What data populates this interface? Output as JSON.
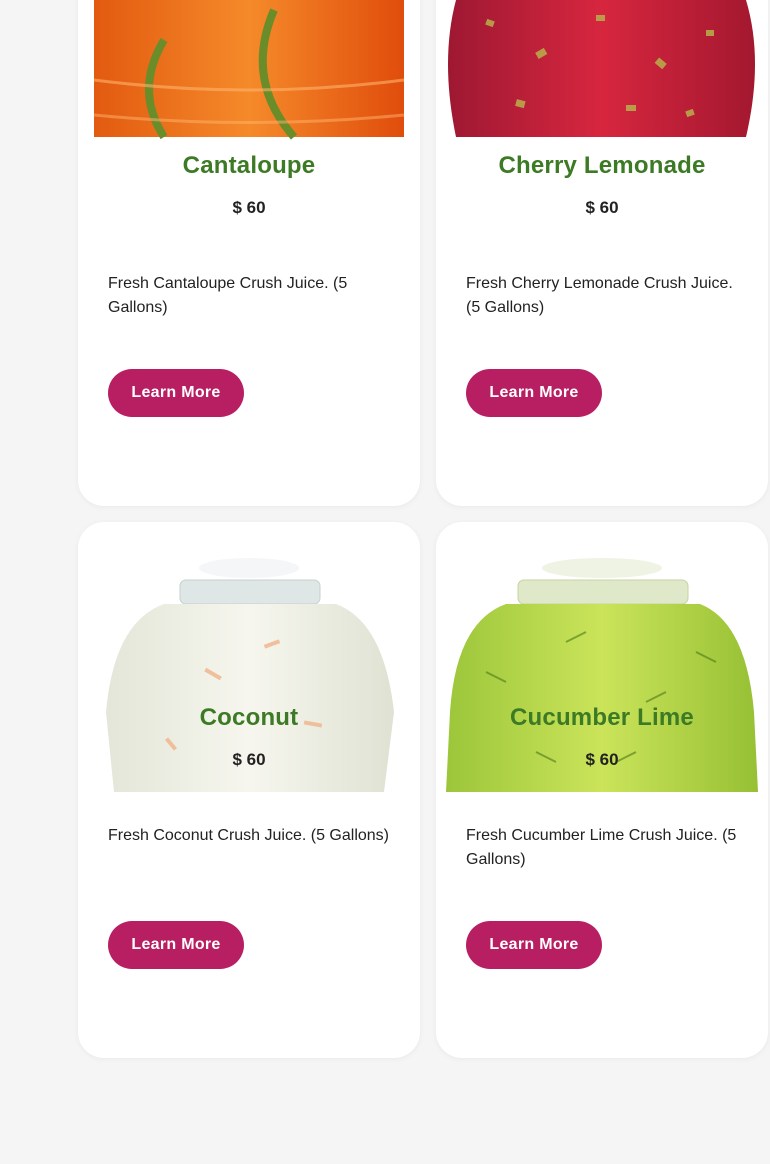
{
  "colors": {
    "title": "#3d7a25",
    "accent": "#b81f63"
  },
  "products": [
    {
      "name": "Cantaloupe",
      "price": "$ 60",
      "description": "Fresh Cantaloupe Crush Juice. (5 Gallons)",
      "button": "Learn More",
      "image_icon": "cantaloupe-jar-icon"
    },
    {
      "name": "Cherry Lemonade",
      "price": "$ 60",
      "description": "Fresh Cherry Lemonade Crush Juice. (5 Gallons)",
      "button": "Learn More",
      "image_icon": "cherry-lemonade-jar-icon"
    },
    {
      "name": "Coconut",
      "price": "$ 60",
      "description": "Fresh Coconut Crush Juice. (5 Gallons)",
      "button": "Learn More",
      "image_icon": "coconut-jar-icon"
    },
    {
      "name": "Cucumber Lime",
      "price": "$ 60",
      "description": "Fresh Cucumber Lime Crush Juice. (5 Gallons)",
      "button": "Learn More",
      "image_icon": "cucumber-lime-jar-icon"
    }
  ]
}
